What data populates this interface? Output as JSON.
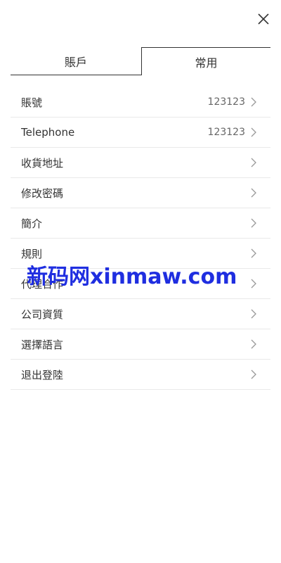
{
  "header": {
    "close_icon": "close-icon"
  },
  "tabs": [
    {
      "label": "賬戶",
      "active": false
    },
    {
      "label": "常用",
      "active": true
    }
  ],
  "menu": {
    "items": [
      {
        "label": "賬號",
        "value": "123123"
      },
      {
        "label": "Telephone",
        "value": "123123"
      },
      {
        "label": "收貨地址",
        "value": ""
      },
      {
        "label": "修改密碼",
        "value": ""
      },
      {
        "label": "簡介",
        "value": ""
      },
      {
        "label": "規則",
        "value": ""
      },
      {
        "label": "代理合作",
        "value": ""
      },
      {
        "label": "公司資質",
        "value": ""
      },
      {
        "label": "選擇語言",
        "value": ""
      },
      {
        "label": "退出登陸",
        "value": ""
      }
    ]
  },
  "watermark": {
    "text": "新码网xinmaw.com",
    "color": "#1f2ee0"
  },
  "colors": {
    "text": "#333333",
    "value_text": "#666666",
    "divider": "#e9e9e9",
    "chevron": "#999999"
  }
}
